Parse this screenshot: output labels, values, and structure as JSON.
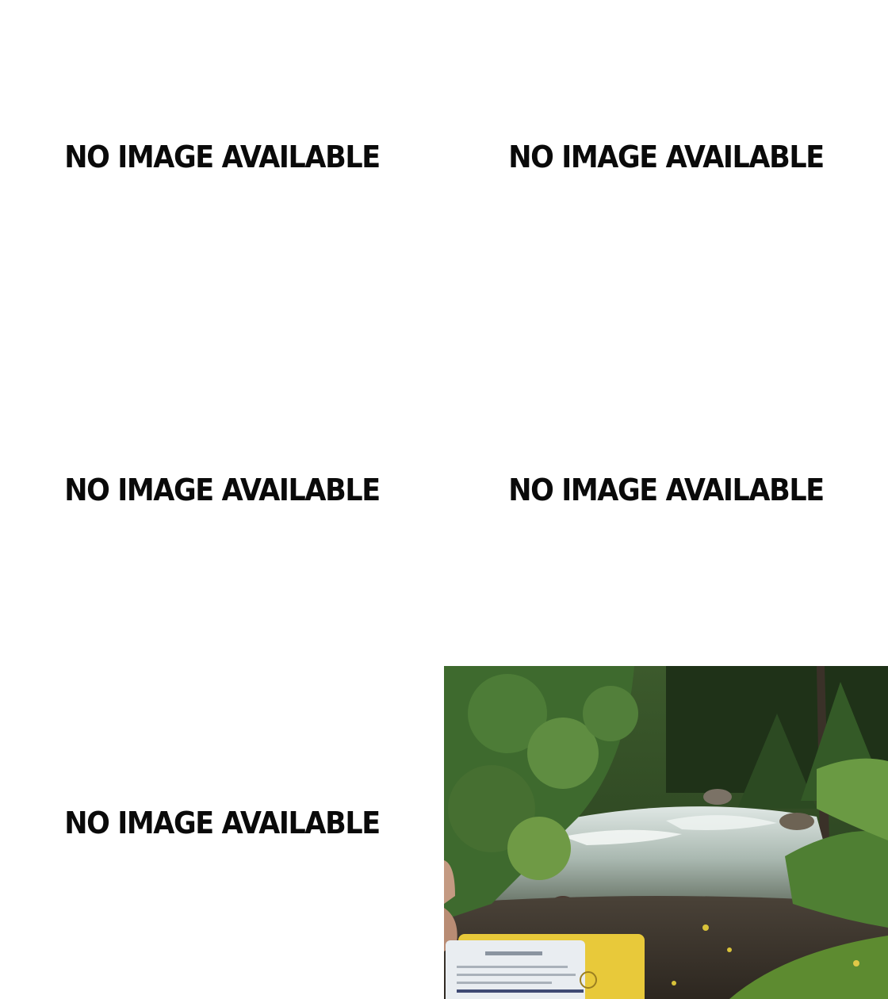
{
  "tiles": [
    {
      "text": "NO IMAGE AVAILABLE"
    },
    {
      "text": "NO IMAGE AVAILABLE"
    },
    {
      "text": "NO IMAGE AVAILABLE"
    },
    {
      "text": "NO IMAGE AVAILABLE"
    },
    {
      "text": "NO IMAGE AVAILABLE"
    }
  ],
  "photo_tile": {
    "icon": "stream-photo",
    "colors": {
      "foliage_dark": "#2f4a23",
      "foliage_light": "#6f9a45",
      "water": "#c7d3cf",
      "rock": "#6b6256",
      "card_yellow": "#e8c93a"
    }
  }
}
